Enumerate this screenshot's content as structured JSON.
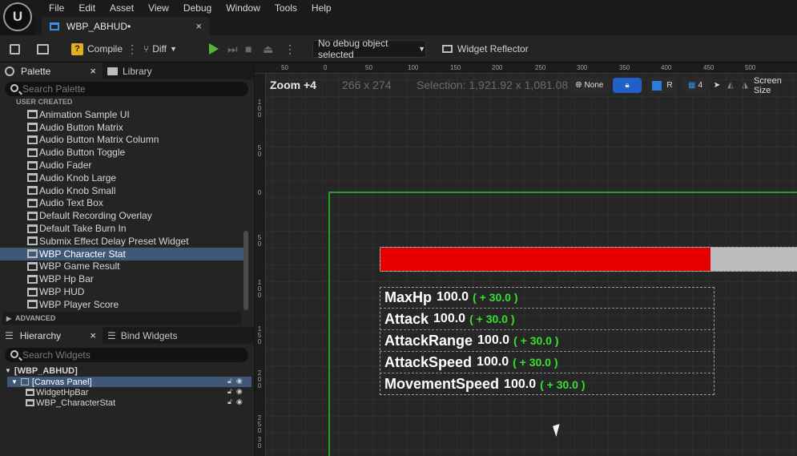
{
  "app": {
    "logo_text": "U"
  },
  "menu": [
    "File",
    "Edit",
    "Asset",
    "View",
    "Debug",
    "Window",
    "Tools",
    "Help"
  ],
  "document_tab": {
    "title": "WBP_ABHUD•",
    "close": "×"
  },
  "toolbar": {
    "compile_label": "Compile",
    "diff_label": "Diff",
    "debug_object": "No debug object selected",
    "widget_reflector": "Widget Reflector"
  },
  "palette": {
    "tab_palette": "Palette",
    "tab_library": "Library",
    "search_placeholder": "Search Palette",
    "category": "USER CREATED",
    "items": [
      "Animation Sample UI",
      "Audio Button Matrix",
      "Audio Button Matrix Column",
      "Audio Button Toggle",
      "Audio Fader",
      "Audio Knob Large",
      "Audio Knob Small",
      "Audio Text Box",
      "Default Recording Overlay",
      "Default Take Burn In",
      "Submix Effect Delay Preset Widget",
      "WBP Character Stat",
      "WBP Game Result",
      "WBP Hp Bar",
      "WBP HUD",
      "WBP Player Score"
    ],
    "selected_index": 11,
    "advanced": "ADVANCED"
  },
  "hierarchy": {
    "tab_hierarchy": "Hierarchy",
    "tab_bind": "Bind Widgets",
    "search_placeholder": "Search Widgets",
    "root": "[WBP_ABHUD]",
    "canvas": "[Canvas Panel]",
    "children": [
      "WidgetHpBar",
      "WBP_CharacterStat"
    ]
  },
  "viewport": {
    "zoom": "Zoom +4",
    "size": "266 x 274",
    "selection": "Selection: 1,921.92 x 1,081.08",
    "none_label": "None",
    "r_label": "R",
    "grid_count": "4",
    "screen_size": "Screen Size",
    "ruler_top": [
      "50",
      "0",
      "50",
      "100",
      "150",
      "200",
      "250",
      "300",
      "350",
      "400",
      "450",
      "500"
    ],
    "ruler_left": [
      "1\n0\n0",
      "5\n0",
      "0",
      "5\n0",
      "1\n0\n0",
      "1\n5\n0",
      "2\n0\n0",
      "2\n5\n0",
      "3\n0"
    ],
    "hp_fraction": 0.787
  },
  "stats": [
    {
      "name": "MaxHp",
      "value": "100.0",
      "bonus": "( + 30.0 )"
    },
    {
      "name": "Attack",
      "value": "100.0",
      "bonus": "( + 30.0 )"
    },
    {
      "name": "AttackRange",
      "value": "100.0",
      "bonus": "( + 30.0 )"
    },
    {
      "name": "AttackSpeed",
      "value": "100.0",
      "bonus": "( + 30.0 )"
    },
    {
      "name": "MovementSpeed",
      "value": "100.0",
      "bonus": "( + 30.0 )"
    }
  ],
  "colors": {
    "hp_fill": "#e60000",
    "bonus": "#33e12c",
    "selection": "#3f5878",
    "canvas_border": "#28a028"
  }
}
